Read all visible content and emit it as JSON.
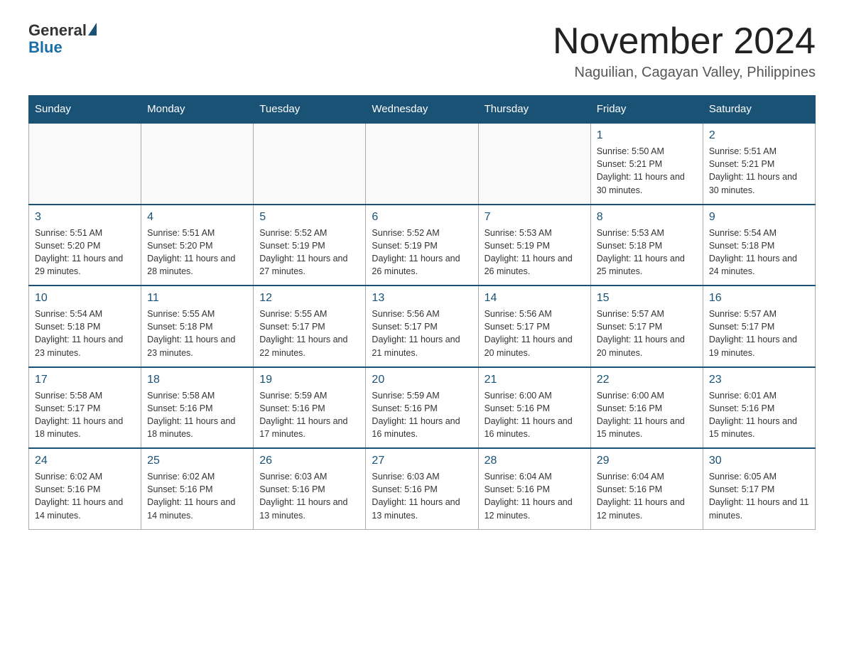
{
  "header": {
    "logo_general": "General",
    "logo_blue": "Blue",
    "month_title": "November 2024",
    "location": "Naguilian, Cagayan Valley, Philippines"
  },
  "days_of_week": [
    "Sunday",
    "Monday",
    "Tuesday",
    "Wednesday",
    "Thursday",
    "Friday",
    "Saturday"
  ],
  "weeks": [
    [
      {
        "day": "",
        "sunrise": "",
        "sunset": "",
        "daylight": ""
      },
      {
        "day": "",
        "sunrise": "",
        "sunset": "",
        "daylight": ""
      },
      {
        "day": "",
        "sunrise": "",
        "sunset": "",
        "daylight": ""
      },
      {
        "day": "",
        "sunrise": "",
        "sunset": "",
        "daylight": ""
      },
      {
        "day": "",
        "sunrise": "",
        "sunset": "",
        "daylight": ""
      },
      {
        "day": "1",
        "sunrise": "Sunrise: 5:50 AM",
        "sunset": "Sunset: 5:21 PM",
        "daylight": "Daylight: 11 hours and 30 minutes."
      },
      {
        "day": "2",
        "sunrise": "Sunrise: 5:51 AM",
        "sunset": "Sunset: 5:21 PM",
        "daylight": "Daylight: 11 hours and 30 minutes."
      }
    ],
    [
      {
        "day": "3",
        "sunrise": "Sunrise: 5:51 AM",
        "sunset": "Sunset: 5:20 PM",
        "daylight": "Daylight: 11 hours and 29 minutes."
      },
      {
        "day": "4",
        "sunrise": "Sunrise: 5:51 AM",
        "sunset": "Sunset: 5:20 PM",
        "daylight": "Daylight: 11 hours and 28 minutes."
      },
      {
        "day": "5",
        "sunrise": "Sunrise: 5:52 AM",
        "sunset": "Sunset: 5:19 PM",
        "daylight": "Daylight: 11 hours and 27 minutes."
      },
      {
        "day": "6",
        "sunrise": "Sunrise: 5:52 AM",
        "sunset": "Sunset: 5:19 PM",
        "daylight": "Daylight: 11 hours and 26 minutes."
      },
      {
        "day": "7",
        "sunrise": "Sunrise: 5:53 AM",
        "sunset": "Sunset: 5:19 PM",
        "daylight": "Daylight: 11 hours and 26 minutes."
      },
      {
        "day": "8",
        "sunrise": "Sunrise: 5:53 AM",
        "sunset": "Sunset: 5:18 PM",
        "daylight": "Daylight: 11 hours and 25 minutes."
      },
      {
        "day": "9",
        "sunrise": "Sunrise: 5:54 AM",
        "sunset": "Sunset: 5:18 PM",
        "daylight": "Daylight: 11 hours and 24 minutes."
      }
    ],
    [
      {
        "day": "10",
        "sunrise": "Sunrise: 5:54 AM",
        "sunset": "Sunset: 5:18 PM",
        "daylight": "Daylight: 11 hours and 23 minutes."
      },
      {
        "day": "11",
        "sunrise": "Sunrise: 5:55 AM",
        "sunset": "Sunset: 5:18 PM",
        "daylight": "Daylight: 11 hours and 23 minutes."
      },
      {
        "day": "12",
        "sunrise": "Sunrise: 5:55 AM",
        "sunset": "Sunset: 5:17 PM",
        "daylight": "Daylight: 11 hours and 22 minutes."
      },
      {
        "day": "13",
        "sunrise": "Sunrise: 5:56 AM",
        "sunset": "Sunset: 5:17 PM",
        "daylight": "Daylight: 11 hours and 21 minutes."
      },
      {
        "day": "14",
        "sunrise": "Sunrise: 5:56 AM",
        "sunset": "Sunset: 5:17 PM",
        "daylight": "Daylight: 11 hours and 20 minutes."
      },
      {
        "day": "15",
        "sunrise": "Sunrise: 5:57 AM",
        "sunset": "Sunset: 5:17 PM",
        "daylight": "Daylight: 11 hours and 20 minutes."
      },
      {
        "day": "16",
        "sunrise": "Sunrise: 5:57 AM",
        "sunset": "Sunset: 5:17 PM",
        "daylight": "Daylight: 11 hours and 19 minutes."
      }
    ],
    [
      {
        "day": "17",
        "sunrise": "Sunrise: 5:58 AM",
        "sunset": "Sunset: 5:17 PM",
        "daylight": "Daylight: 11 hours and 18 minutes."
      },
      {
        "day": "18",
        "sunrise": "Sunrise: 5:58 AM",
        "sunset": "Sunset: 5:16 PM",
        "daylight": "Daylight: 11 hours and 18 minutes."
      },
      {
        "day": "19",
        "sunrise": "Sunrise: 5:59 AM",
        "sunset": "Sunset: 5:16 PM",
        "daylight": "Daylight: 11 hours and 17 minutes."
      },
      {
        "day": "20",
        "sunrise": "Sunrise: 5:59 AM",
        "sunset": "Sunset: 5:16 PM",
        "daylight": "Daylight: 11 hours and 16 minutes."
      },
      {
        "day": "21",
        "sunrise": "Sunrise: 6:00 AM",
        "sunset": "Sunset: 5:16 PM",
        "daylight": "Daylight: 11 hours and 16 minutes."
      },
      {
        "day": "22",
        "sunrise": "Sunrise: 6:00 AM",
        "sunset": "Sunset: 5:16 PM",
        "daylight": "Daylight: 11 hours and 15 minutes."
      },
      {
        "day": "23",
        "sunrise": "Sunrise: 6:01 AM",
        "sunset": "Sunset: 5:16 PM",
        "daylight": "Daylight: 11 hours and 15 minutes."
      }
    ],
    [
      {
        "day": "24",
        "sunrise": "Sunrise: 6:02 AM",
        "sunset": "Sunset: 5:16 PM",
        "daylight": "Daylight: 11 hours and 14 minutes."
      },
      {
        "day": "25",
        "sunrise": "Sunrise: 6:02 AM",
        "sunset": "Sunset: 5:16 PM",
        "daylight": "Daylight: 11 hours and 14 minutes."
      },
      {
        "day": "26",
        "sunrise": "Sunrise: 6:03 AM",
        "sunset": "Sunset: 5:16 PM",
        "daylight": "Daylight: 11 hours and 13 minutes."
      },
      {
        "day": "27",
        "sunrise": "Sunrise: 6:03 AM",
        "sunset": "Sunset: 5:16 PM",
        "daylight": "Daylight: 11 hours and 13 minutes."
      },
      {
        "day": "28",
        "sunrise": "Sunrise: 6:04 AM",
        "sunset": "Sunset: 5:16 PM",
        "daylight": "Daylight: 11 hours and 12 minutes."
      },
      {
        "day": "29",
        "sunrise": "Sunrise: 6:04 AM",
        "sunset": "Sunset: 5:16 PM",
        "daylight": "Daylight: 11 hours and 12 minutes."
      },
      {
        "day": "30",
        "sunrise": "Sunrise: 6:05 AM",
        "sunset": "Sunset: 5:17 PM",
        "daylight": "Daylight: 11 hours and 11 minutes."
      }
    ]
  ]
}
